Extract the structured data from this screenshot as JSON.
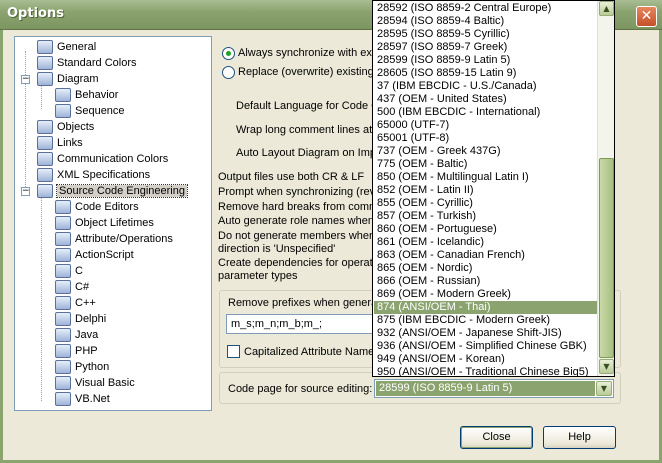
{
  "window": {
    "title": "Options"
  },
  "tree": {
    "items": [
      {
        "label": "General",
        "icon": "general-icon",
        "level": 1
      },
      {
        "label": "Standard Colors",
        "icon": "palette-icon",
        "level": 1
      },
      {
        "label": "Diagram",
        "icon": "diagram-icon",
        "level": 1,
        "expanded": true
      },
      {
        "label": "Behavior",
        "icon": "behavior-icon",
        "level": 2
      },
      {
        "label": "Sequence",
        "icon": "sequence-icon",
        "level": 2
      },
      {
        "label": "Objects",
        "icon": "objects-icon",
        "level": 1
      },
      {
        "label": "Links",
        "icon": "links-icon",
        "level": 1
      },
      {
        "label": "Communication Colors",
        "icon": "communication-colors-icon",
        "level": 1
      },
      {
        "label": "XML Specifications",
        "icon": "xml-icon",
        "level": 1
      },
      {
        "label": "Source Code Engineering",
        "icon": "source-code-icon",
        "level": 1,
        "expanded": true,
        "selected": true
      },
      {
        "label": "Code Editors",
        "icon": "code-editors-icon",
        "level": 2
      },
      {
        "label": "Object Lifetimes",
        "icon": "object-lifetimes-icon",
        "level": 2
      },
      {
        "label": "Attribute/Operations",
        "icon": "attribute-operations-icon",
        "level": 2
      },
      {
        "label": "ActionScript",
        "icon": "actionscript-icon",
        "level": 2
      },
      {
        "label": "C",
        "icon": "c-icon",
        "level": 2
      },
      {
        "label": "C#",
        "icon": "csharp-icon",
        "level": 2
      },
      {
        "label": "C++",
        "icon": "cpp-icon",
        "level": 2
      },
      {
        "label": "Delphi",
        "icon": "delphi-icon",
        "level": 2
      },
      {
        "label": "Java",
        "icon": "java-icon",
        "level": 2
      },
      {
        "label": "PHP",
        "icon": "php-icon",
        "level": 2
      },
      {
        "label": "Python",
        "icon": "python-icon",
        "level": 2
      },
      {
        "label": "Visual Basic",
        "icon": "visual-basic-icon",
        "level": 2
      },
      {
        "label": "VB.Net",
        "icon": "vbnet-icon",
        "level": 2
      }
    ]
  },
  "panel": {
    "radio_always": "Always synchronize with exis",
    "radio_replace": "Replace (overwrite) existing s",
    "default_language": "Default Language for Code G",
    "wrap_comment": "Wrap long comment lines at:",
    "auto_layout": "Auto Layout Diagram on Impo",
    "output_crlf": "Output files use both CR & LF",
    "prompt_sync": "Prompt when synchronizing (reve",
    "remove_breaks": "Remove hard breaks from  comm",
    "auto_role": "Auto generate role names when c",
    "no_members_1": "Do not generate members where",
    "no_members_2": "direction is 'Unspecified'",
    "create_deps_1": "Create dependencies for operatio",
    "create_deps_2": "parameter types",
    "remove_prefixes": "Remove prefixes when generat",
    "prefixes_value": "m_s;m_n;m_b;m_;",
    "capitalized": "Capitalized Attribute Name f",
    "code_page_label": "Code page for source editing:",
    "code_page_value": "28599 (ISO 8859-9 Latin 5)"
  },
  "dropdown": {
    "options": [
      "28592 (ISO 8859-2 Central Europe)",
      "28594 (ISO 8859-4 Baltic)",
      "28595 (ISO 8859-5 Cyrillic)",
      "28597 (ISO 8859-7 Greek)",
      "28599 (ISO 8859-9 Latin 5)",
      "28605 (ISO 8859-15 Latin 9)",
      "37    (IBM EBCDIC - U.S./Canada)",
      "437   (OEM - United States)",
      "500   (IBM EBCDIC - International)",
      "65000 (UTF-7)",
      "65001 (UTF-8)",
      "737   (OEM - Greek 437G)",
      "775   (OEM - Baltic)",
      "850   (OEM - Multilingual Latin I)",
      "852   (OEM - Latin II)",
      "855   (OEM - Cyrillic)",
      "857   (OEM - Turkish)",
      "860   (OEM - Portuguese)",
      "861   (OEM - Icelandic)",
      "863   (OEM - Canadian French)",
      "865   (OEM - Nordic)",
      "866   (OEM - Russian)",
      "869   (OEM - Modern Greek)",
      "874   (ANSI/OEM - Thai)",
      "875   (IBM EBCDIC - Modern Greek)",
      "932   (ANSI/OEM - Japanese Shift-JIS)",
      "936   (ANSI/OEM - Simplified Chinese GBK)",
      "949   (ANSI/OEM - Korean)",
      "950   (ANSI/OEM - Traditional Chinese Big5)"
    ],
    "selected_index": 23
  },
  "buttons": {
    "close": "Close",
    "help": "Help"
  },
  "colors": {
    "accent": "#8ba36f",
    "window_bg": "#ece9d8"
  }
}
